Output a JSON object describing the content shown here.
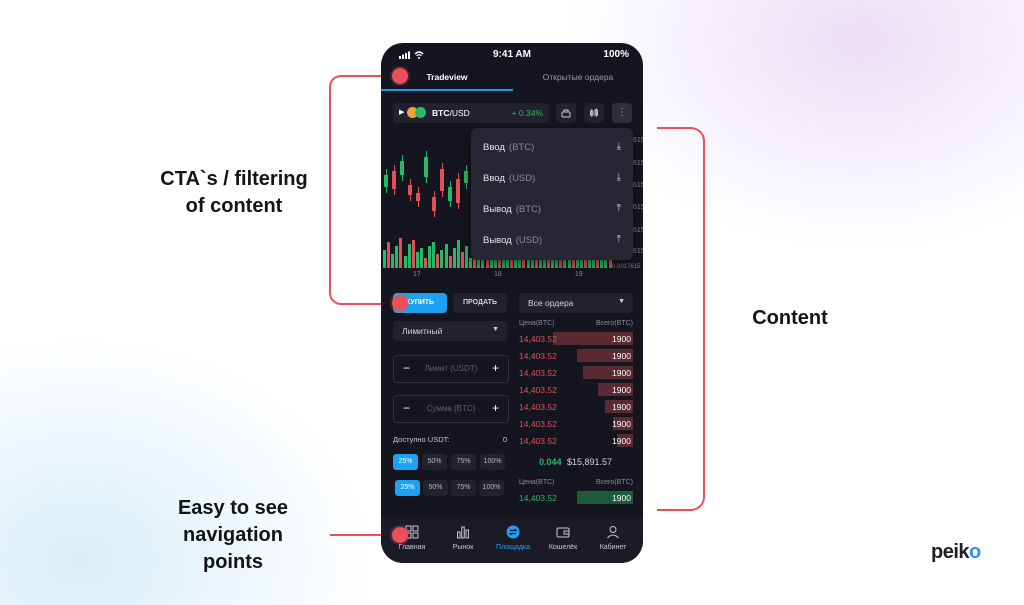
{
  "annotations": {
    "cta": [
      "CTA`s / filtering",
      "of content"
    ],
    "content": "Content",
    "nav": [
      "Easy to see",
      "navigation",
      "points"
    ]
  },
  "logo": {
    "prefix": "peik",
    "suffix": "o"
  },
  "status_bar": {
    "time": "9:41 AM",
    "battery": "100%"
  },
  "tabs": {
    "active": "Tradeview",
    "inactive": "Открытые ордера"
  },
  "pair": {
    "symbol": "BTC",
    "quote": "/USD",
    "change": "+ 0.34%"
  },
  "dropdown_items": [
    {
      "label": "Ввод",
      "unit": "(BTC)",
      "icon": "download-icon"
    },
    {
      "label": "Ввод",
      "unit": "(USD)",
      "icon": "download-icon"
    },
    {
      "label": "Вывод",
      "unit": "(BTC)",
      "icon": "upload-icon"
    },
    {
      "label": "Вывод",
      "unit": "(USD)",
      "icon": "upload-icon"
    }
  ],
  "chart_axis": {
    "x_ticks": [
      "17",
      "18",
      "19"
    ],
    "y_right_ticks": [
      "615",
      "615",
      "615",
      "615",
      "615",
      "615",
      "615"
    ],
    "volume_label": "0.0017615"
  },
  "order_form": {
    "buy_label": "КУПИТЬ",
    "sell_label": "ПРОДАТЬ",
    "order_type": "Лимитный",
    "limit_placeholder": "Лимит (USDT)",
    "amount_placeholder": "Сумма (BTC)",
    "available_label": "Доступно USDT:",
    "available_value": "0",
    "percent_options": [
      "25%",
      "50%",
      "75%",
      "100%"
    ]
  },
  "order_book": {
    "filter": "Все ордера",
    "price_header": "Цена(BTC)",
    "total_header": "Всего(BTC)",
    "asks": [
      {
        "price": "14,403.52",
        "total": "1900",
        "depth": 1.0
      },
      {
        "price": "14,403.52",
        "total": "1900",
        "depth": 0.7
      },
      {
        "price": "14,403.52",
        "total": "1900",
        "depth": 0.62
      },
      {
        "price": "14,403.52",
        "total": "1900",
        "depth": 0.44
      },
      {
        "price": "14,403.52",
        "total": "1900",
        "depth": 0.35
      },
      {
        "price": "14,403.52",
        "total": "1900",
        "depth": 0.25
      },
      {
        "price": "14,403.52",
        "total": "1900",
        "depth": 0.2
      }
    ],
    "mid_qty": "0.044",
    "mid_price": "$15,891.57",
    "bids": [
      {
        "price": "14,403.52",
        "total": "1900",
        "depth": 0.7
      }
    ]
  },
  "nav": [
    {
      "label": "Главная",
      "icon": "grid-icon"
    },
    {
      "label": "Рынок",
      "icon": "chart-icon"
    },
    {
      "label": "Площадка",
      "icon": "exchange-icon"
    },
    {
      "label": "Кошелёк",
      "icon": "wallet-icon"
    },
    {
      "label": "Кабинет",
      "icon": "user-icon"
    }
  ],
  "colors": {
    "accent": "#1da2f2",
    "ask": "#e0505a",
    "bid": "#27b86a",
    "annotation": "#e8505b"
  }
}
